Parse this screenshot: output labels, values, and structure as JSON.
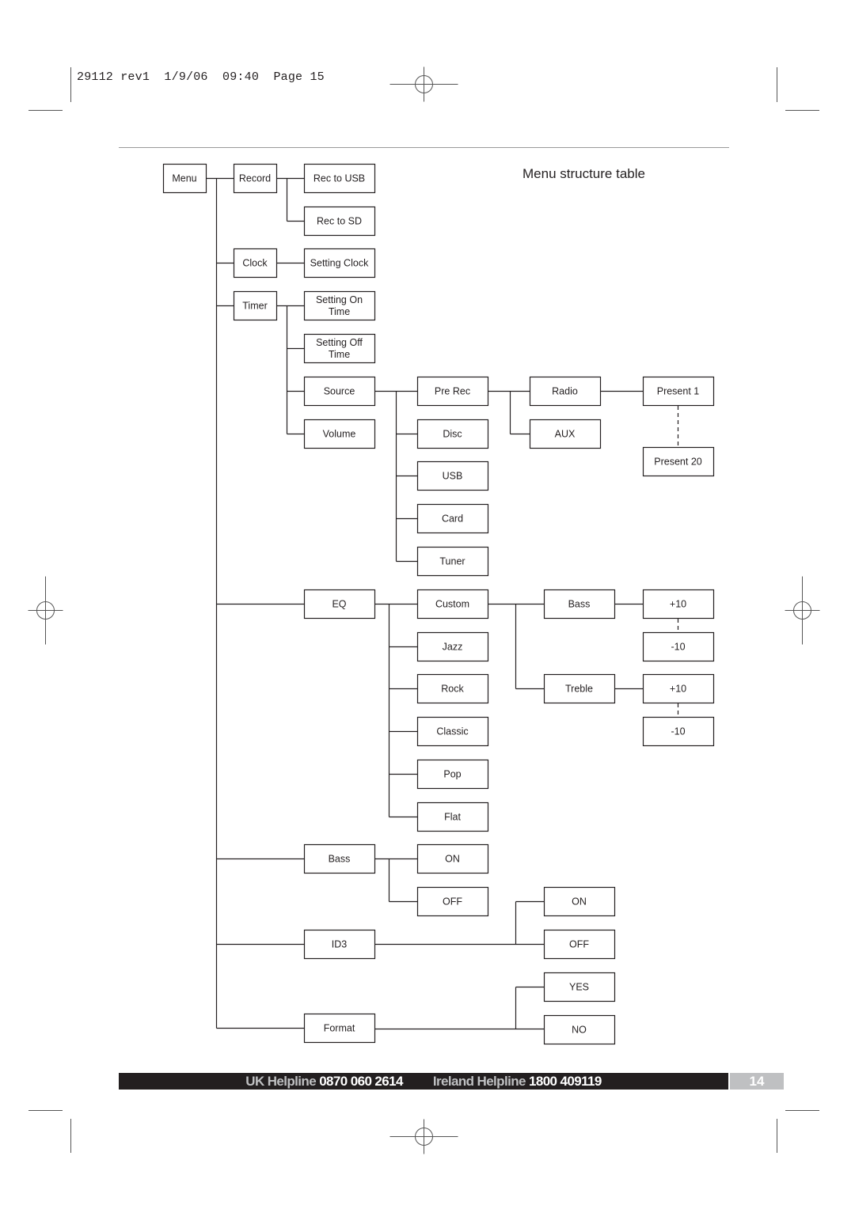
{
  "header": {
    "slug": "29112 rev1  1/9/06  09:40  Page 15",
    "title": "Menu structure table"
  },
  "footer": {
    "uk_label": "UK Helpline",
    "uk_number": "0870 060 2614",
    "ireland_label": "Ireland Helpline",
    "ireland_number": "1800 409119",
    "page_number": "14"
  },
  "colors": {
    "ink": "#231f20",
    "footer_bg": "#231f20",
    "page_tab_bg": "#bfc0c2"
  },
  "menu_tree": {
    "label": "Menu",
    "children": [
      {
        "label": "Record",
        "children": [
          {
            "label": "Rec to USB"
          },
          {
            "label": "Rec to SD"
          }
        ]
      },
      {
        "label": "Clock",
        "children": [
          {
            "label": "Setting Clock"
          }
        ]
      },
      {
        "label": "Timer",
        "children": [
          {
            "label": "Setting On Time"
          },
          {
            "label": "Setting Off Time"
          },
          {
            "label": "Source",
            "children": [
              {
                "label": "Pre Rec",
                "children": [
                  {
                    "label": "Radio",
                    "children": [
                      {
                        "label": "Present 1"
                      },
                      {
                        "label": "Present 20"
                      }
                    ]
                  },
                  {
                    "label": "AUX"
                  }
                ]
              },
              {
                "label": "Disc"
              },
              {
                "label": "USB"
              },
              {
                "label": "Card"
              },
              {
                "label": "Tuner"
              }
            ]
          },
          {
            "label": "Volume"
          }
        ]
      },
      {
        "label": "EQ",
        "children": [
          {
            "label": "Custom",
            "children": [
              {
                "label": "Bass",
                "children": [
                  {
                    "label": "+10"
                  },
                  {
                    "label": "-10"
                  }
                ]
              },
              {
                "label": "Treble",
                "children": [
                  {
                    "label": "+10"
                  },
                  {
                    "label": "-10"
                  }
                ]
              }
            ]
          },
          {
            "label": "Jazz"
          },
          {
            "label": "Rock"
          },
          {
            "label": "Classic"
          },
          {
            "label": "Pop"
          },
          {
            "label": "Flat"
          }
        ]
      },
      {
        "label": "Bass",
        "children": [
          {
            "label": "ON"
          },
          {
            "label": "OFF"
          }
        ]
      },
      {
        "label": "ID3",
        "children": [
          {
            "label": "ON"
          },
          {
            "label": "OFF"
          }
        ]
      },
      {
        "label": "Format",
        "children": [
          {
            "label": "YES"
          },
          {
            "label": "NO"
          }
        ]
      }
    ]
  },
  "nodes": [
    {
      "id": "menu",
      "lines": [
        "Menu"
      ]
    },
    {
      "id": "record",
      "lines": [
        "Record"
      ]
    },
    {
      "id": "rec-usb",
      "lines": [
        "Rec to USB"
      ]
    },
    {
      "id": "rec-sd",
      "lines": [
        "Rec to SD"
      ]
    },
    {
      "id": "clock",
      "lines": [
        "Clock"
      ]
    },
    {
      "id": "setting-clock",
      "lines": [
        "Setting Clock"
      ]
    },
    {
      "id": "timer",
      "lines": [
        "Timer"
      ]
    },
    {
      "id": "setting-on",
      "lines": [
        "Setting On",
        "Time"
      ]
    },
    {
      "id": "setting-off",
      "lines": [
        "Setting Off",
        "Time"
      ]
    },
    {
      "id": "source",
      "lines": [
        "Source"
      ]
    },
    {
      "id": "volume",
      "lines": [
        "Volume"
      ]
    },
    {
      "id": "pre-rec",
      "lines": [
        "Pre Rec"
      ]
    },
    {
      "id": "disc",
      "lines": [
        "Disc"
      ]
    },
    {
      "id": "usb",
      "lines": [
        "USB"
      ]
    },
    {
      "id": "card",
      "lines": [
        "Card"
      ]
    },
    {
      "id": "tuner",
      "lines": [
        "Tuner"
      ]
    },
    {
      "id": "radio",
      "lines": [
        "Radio"
      ]
    },
    {
      "id": "aux",
      "lines": [
        "AUX"
      ]
    },
    {
      "id": "present-1",
      "lines": [
        "Present 1"
      ]
    },
    {
      "id": "present-20",
      "lines": [
        "Present 20"
      ]
    },
    {
      "id": "eq",
      "lines": [
        "EQ"
      ]
    },
    {
      "id": "custom",
      "lines": [
        "Custom"
      ]
    },
    {
      "id": "jazz",
      "lines": [
        "Jazz"
      ]
    },
    {
      "id": "rock",
      "lines": [
        "Rock"
      ]
    },
    {
      "id": "classic",
      "lines": [
        "Classic"
      ]
    },
    {
      "id": "pop",
      "lines": [
        "Pop"
      ]
    },
    {
      "id": "flat",
      "lines": [
        "Flat"
      ]
    },
    {
      "id": "eq-bass",
      "lines": [
        "Bass"
      ]
    },
    {
      "id": "eq-treble",
      "lines": [
        "Treble"
      ]
    },
    {
      "id": "bass-plus",
      "lines": [
        "+10"
      ]
    },
    {
      "id": "bass-minus",
      "lines": [
        "-10"
      ]
    },
    {
      "id": "treble-plus",
      "lines": [
        "+10"
      ]
    },
    {
      "id": "treble-minus",
      "lines": [
        "-10"
      ]
    },
    {
      "id": "bass",
      "lines": [
        "Bass"
      ]
    },
    {
      "id": "bass-on",
      "lines": [
        "ON"
      ]
    },
    {
      "id": "bass-off",
      "lines": [
        "OFF"
      ]
    },
    {
      "id": "id3",
      "lines": [
        "ID3"
      ]
    },
    {
      "id": "id3-on",
      "lines": [
        "ON"
      ]
    },
    {
      "id": "id3-off",
      "lines": [
        "OFF"
      ]
    },
    {
      "id": "format",
      "lines": [
        "Format"
      ]
    },
    {
      "id": "format-yes",
      "lines": [
        "YES"
      ]
    },
    {
      "id": "format-no",
      "lines": [
        "NO"
      ]
    }
  ]
}
